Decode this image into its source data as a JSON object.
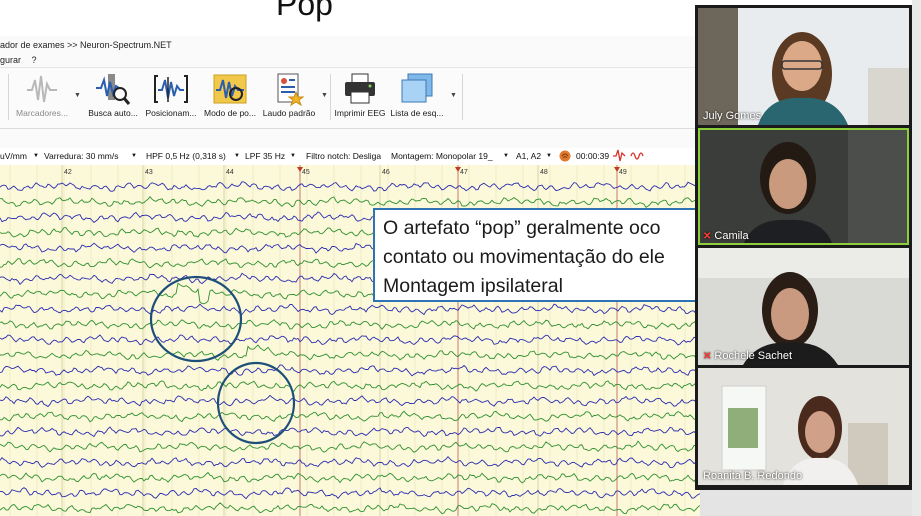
{
  "slide": {
    "title": "Pop"
  },
  "app": {
    "breadcrumb": "ador de exames >> Neuron-Spectrum.NET",
    "menu": [
      "gurar",
      "?"
    ],
    "toolbar": [
      {
        "label": "Marcadores...",
        "icon": "markers-icon",
        "disabled": true
      },
      {
        "label": "Busca auto...",
        "icon": "auto-search-icon"
      },
      {
        "label": "Posicionam...",
        "icon": "positioning-icon"
      },
      {
        "label": "Modo de po...",
        "icon": "mode-icon"
      },
      {
        "label": "Laudo padrão",
        "icon": "report-icon"
      },
      {
        "label": "Imprimir EEG",
        "icon": "printer-icon"
      },
      {
        "label": "Lista de esq...",
        "icon": "list-icon"
      }
    ],
    "status": {
      "sensitivity": "uV/mm",
      "sweep": "Varredura: 30 mm/s",
      "hpf": "HPF 0,5 Hz (0,318 s)",
      "lpf": "LPF 35 Hz",
      "notch": "Filtro notch: Desliga",
      "montage": "Montagem: Monopolar 19_",
      "reference": "A1, A2",
      "time": "00:00:39"
    },
    "seconds": [
      "42",
      "43",
      "44",
      "45",
      "46",
      "47",
      "48",
      "49"
    ]
  },
  "annotation": {
    "lines": [
      "O artefato “pop” geralmente oco",
      "contato ou movimentação do ele",
      "Montagem ipsilateral"
    ]
  },
  "participants": [
    {
      "name": "July Gomes",
      "muted": false,
      "active": false
    },
    {
      "name": "Camila",
      "muted": true,
      "active": true
    },
    {
      "name": "Rochele Sachet",
      "muted": true,
      "active": false
    },
    {
      "name": "Roanita B. Redondo",
      "muted": false,
      "active": false
    }
  ],
  "colors": {
    "trace_blue": "#2b2bb0",
    "trace_green": "#2f8f2f",
    "eeg_bg": "#fbf9d9",
    "callout_border": "#2e74b5",
    "highlight_circle": "#1e4f7a"
  }
}
